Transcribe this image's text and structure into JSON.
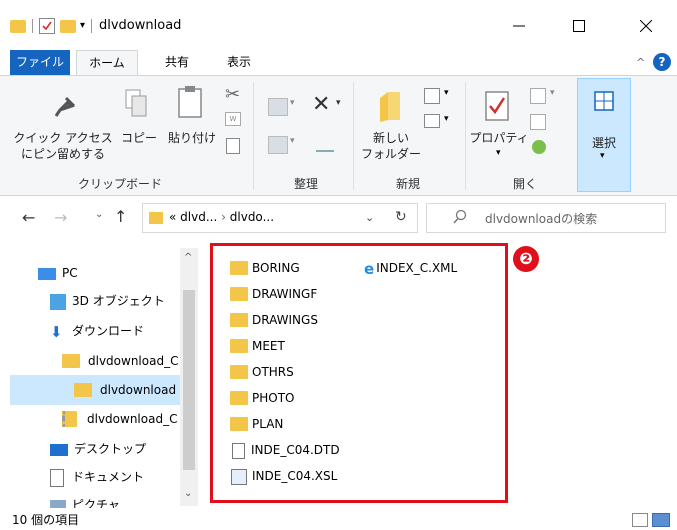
{
  "window": {
    "title": "dlvdownload"
  },
  "tabs": [
    "ファイル",
    "ホーム",
    "共有",
    "表示"
  ],
  "ribbon": {
    "clipboard": {
      "pin_label_1": "クイック アクセス",
      "pin_label_2": "にピン留めする",
      "copy_label": "コピー",
      "paste_label": "貼り付け",
      "group_label": "クリップボード"
    },
    "organize": {
      "group_label": "整理"
    },
    "new": {
      "folder_label_1": "新しい",
      "folder_label_2": "フォルダー",
      "group_label": "新規"
    },
    "open": {
      "properties_label": "プロパティ",
      "group_label": "開く"
    },
    "select": {
      "select_label": "選択"
    }
  },
  "address": {
    "crumb_prefix": "«",
    "crumb_1": "dlvd...",
    "separator": "›",
    "crumb_2": "dlvdo...",
    "search_placeholder": "dlvdownloadの検索"
  },
  "nav": {
    "items": [
      {
        "label": "PC",
        "icon": "pc-icon"
      },
      {
        "label": "3D オブジェクト",
        "icon": "3d-objects-icon"
      },
      {
        "label": "ダウンロード",
        "icon": "download-icon"
      },
      {
        "label": "dlvdownload_C",
        "icon": "folder-icon"
      },
      {
        "label": "dlvdownload",
        "icon": "folder-icon"
      },
      {
        "label": "dlvdownload_C",
        "icon": "zip-folder-icon"
      },
      {
        "label": "デスクトップ",
        "icon": "desktop-icon"
      },
      {
        "label": "ドキュメント",
        "icon": "documents-icon"
      },
      {
        "label": "ピクチャ",
        "icon": "pictures-icon"
      }
    ]
  },
  "files": {
    "col1": [
      {
        "name": "BORING",
        "type": "folder"
      },
      {
        "name": "DRAWINGF",
        "type": "folder"
      },
      {
        "name": "DRAWINGS",
        "type": "folder"
      },
      {
        "name": "MEET",
        "type": "folder"
      },
      {
        "name": "OTHRS",
        "type": "folder"
      },
      {
        "name": "PHOTO",
        "type": "folder"
      },
      {
        "name": "PLAN",
        "type": "folder"
      },
      {
        "name": "INDE_C04.DTD",
        "type": "file"
      },
      {
        "name": "INDE_C04.XSL",
        "type": "xsl"
      }
    ],
    "col2": [
      {
        "name": "INDEX_C.XML",
        "type": "xml"
      }
    ]
  },
  "annotation": {
    "badge": "❷",
    "color": "#e0101a"
  },
  "status": {
    "item_count": "10 個の項目"
  },
  "colors": {
    "accent": "#1565c0",
    "folder": "#f3c64a",
    "selected": "#cce8ff"
  }
}
